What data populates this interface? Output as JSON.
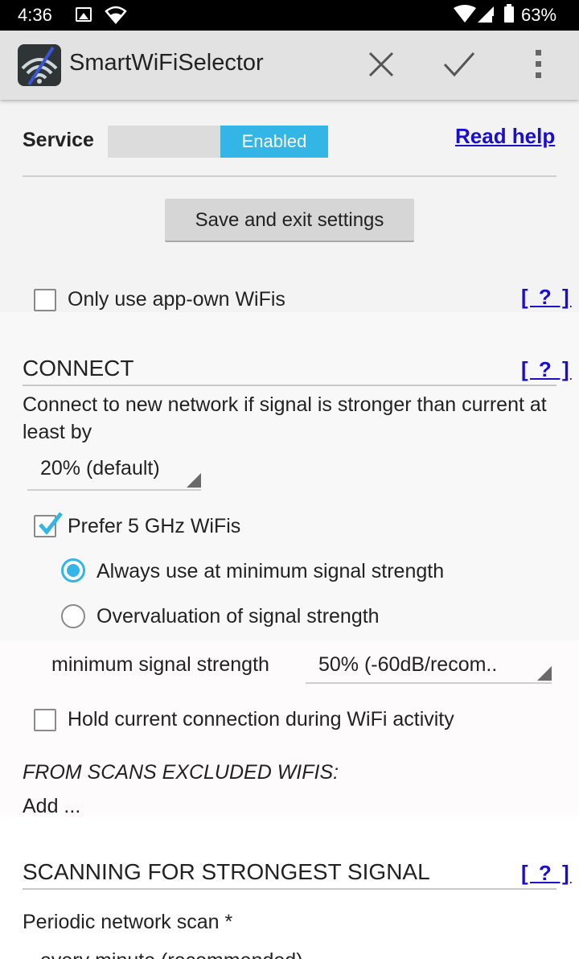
{
  "status_bar": {
    "time": "4:36",
    "battery": "63%"
  },
  "app_bar": {
    "title": "SmartWiFiSelector"
  },
  "service": {
    "label": "Service",
    "toggle_state": "Enabled",
    "help_link": "Read help"
  },
  "save_button": "Save and exit settings",
  "only_app_own": {
    "label": "Only use app-own WiFis",
    "checked": false,
    "help": "[ ? ]"
  },
  "connect": {
    "title": "CONNECT",
    "help": "[ ? ]",
    "description": "Connect to new network if signal is stronger than current at least by",
    "threshold_value": "20% (default)",
    "prefer_5ghz": {
      "label": "Prefer 5 GHz WiFis",
      "checked": true
    },
    "radio_always": "Always use at minimum signal strength",
    "radio_overvaluation": "Overvaluation of signal strength",
    "min_signal_label": "minimum signal strength",
    "min_signal_value": "50% (-60dB/recom..",
    "hold_connection": {
      "label": "Hold current connection during WiFi activity",
      "checked": false
    },
    "excluded_title": "FROM SCANS EXCLUDED WIFIS:",
    "add_label": "Add ..."
  },
  "scanning": {
    "title": "SCANNING FOR STRONGEST SIGNAL",
    "help": "[ ? ]",
    "periodic_label": "Periodic network scan *",
    "periodic_value": "every minute (recommended)"
  },
  "colors": {
    "accent": "#33b5e5",
    "link": "#1a0dcc",
    "background": "#f3f3f3"
  }
}
